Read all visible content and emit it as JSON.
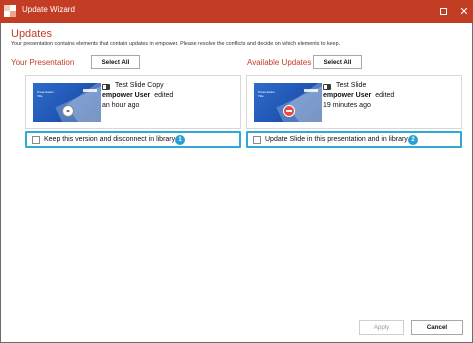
{
  "window": {
    "title": "Update Wizard",
    "maximize_icon": "maximize-icon",
    "close_glyph": "✕"
  },
  "header": {
    "heading": "Updates",
    "subtitle": "Your presentation contains elements that contain updates in empower. Please resolve the conflicts and decide on which elements to keep."
  },
  "left": {
    "column_title": "Your Presentation",
    "select_all": "Select All",
    "slide_name": "Test Slide Copy",
    "user": "empower User",
    "action": "edited",
    "time": "an hour ago",
    "option_label": "Keep this version and disconnect in library",
    "option_number": "1",
    "option_checked": false,
    "badge_icon": "link-icon"
  },
  "right": {
    "column_title": "Available Updates",
    "select_all": "Select All",
    "slide_name": "Test Slide",
    "user": "empower User",
    "action": "edited",
    "time": "19 minutes ago",
    "option_label": "Update Slide in this presentation and in library",
    "option_number": "2",
    "option_checked": false,
    "badge_icon": "no-entry-icon"
  },
  "footer": {
    "apply": "Apply",
    "cancel": "Cancel"
  },
  "colors": {
    "titlebar": "#c33d25",
    "accent": "#c33d25",
    "highlight": "#31a9d6",
    "number_badge": "#2a9fd3"
  }
}
